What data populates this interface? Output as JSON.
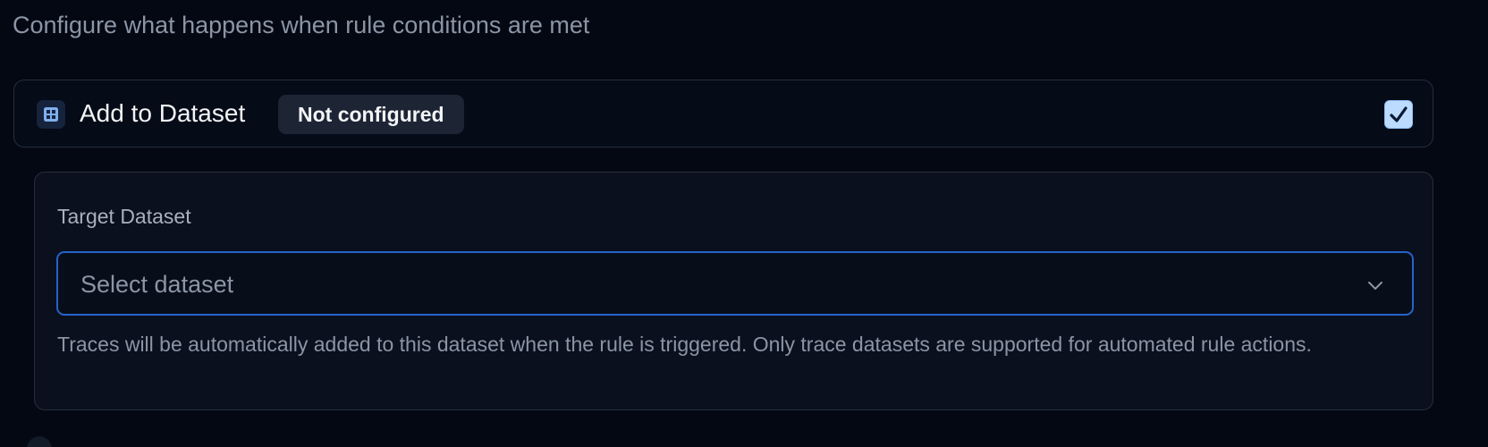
{
  "header": {
    "subtitle": "Configure what happens when rule conditions are met"
  },
  "action": {
    "icon": "grid-icon",
    "title": "Add to Dataset",
    "status_badge": "Not configured",
    "enabled": true
  },
  "config": {
    "field_label": "Target Dataset",
    "select": {
      "selected_value": "Select dataset"
    },
    "help_text": "Traces will be automatically added to this dataset when the rule is triggered. Only trace datasets are supported for automated rule actions."
  },
  "colors": {
    "background": "#030813",
    "accent_border": "#2563c9",
    "checkbox_fill": "#bcdcff",
    "icon_tile": "#16233d",
    "icon_glyph": "#7fb0ee"
  }
}
